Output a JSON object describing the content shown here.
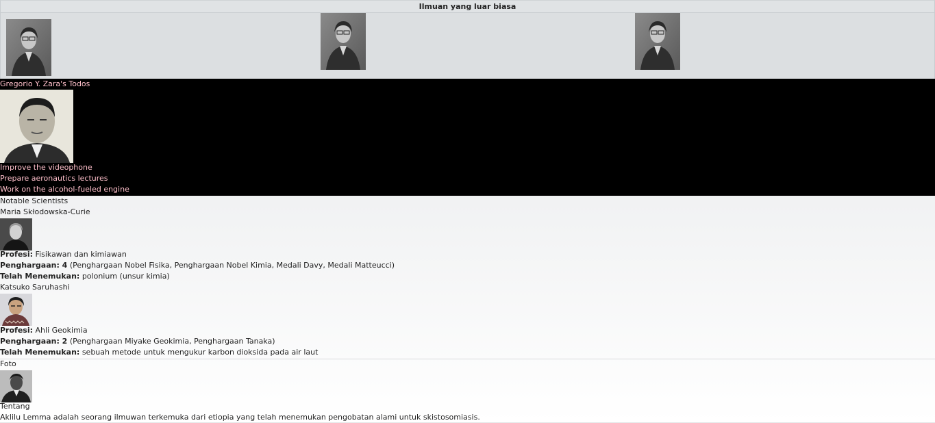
{
  "gallery": {
    "title": "Ilmuan yang luar biasa"
  },
  "todos": {
    "title": "Gregorio Y. Zara's Todos",
    "items": [
      "Improve the videophone",
      "Prepare aeronautics lectures",
      "Work on the alcohol-fueled engine"
    ]
  },
  "scientists": {
    "heading": "Notable Scientists",
    "people": [
      {
        "name": "Maria Skłodowska-Curie",
        "profession_label": "Profesi:",
        "profession": "Fisikawan dan kimiawan",
        "awards_label": "Penghargaan: 4",
        "awards": "(Penghargaan Nobel Fisika, Penghargaan Nobel Kimia, Medali Davy, Medali Matteucci)",
        "discovered_label": "Telah Menemukan:",
        "discovered": "polonium (unsur kimia)"
      },
      {
        "name": "Katsuko Saruhashi",
        "profession_label": "Profesi:",
        "profession": "Ahli Geokimia",
        "awards_label": "Penghargaan: 2",
        "awards": "(Penghargaan Miyake Geokimia, Penghargaan Tanaka)",
        "discovered_label": "Telah Menemukan:",
        "discovered": "sebuah metode untuk mengukur karbon dioksida pada air laut"
      }
    ]
  },
  "profile": {
    "photo_label": "Foto",
    "about_label": "Tentang",
    "about_text": "Aklilu Lemma adalah seorang ilmuwan terkemuka dari etiopia yang telah menemukan pengobatan alami untuk skistosomiasis."
  }
}
